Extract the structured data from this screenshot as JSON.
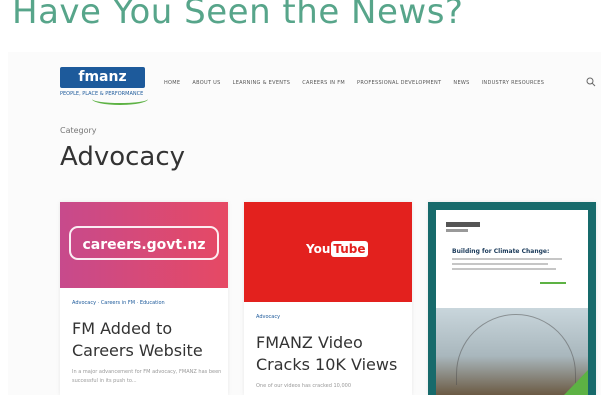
{
  "headline": "Have You Seen the News?",
  "site": {
    "logo_text": "fmanz",
    "logo_tagline": "PEOPLE, PLACE & PERFORMANCE",
    "nav": [
      "HOME",
      "ABOUT US",
      "LEARNING & EVENTS",
      "CAREERS IN FM",
      "PROFESSIONAL DEVELOPMENT",
      "NEWS",
      "INDUSTRY RESOURCES"
    ],
    "search_icon": "search-icon"
  },
  "page": {
    "category_label": "Category",
    "title": "Advocacy"
  },
  "cards": [
    {
      "image_text": "careers.govt.nz",
      "tags": "Advocacy · Careers in FM · Education",
      "title": "FM Added to Careers Website",
      "excerpt": "In a major advancement for FM advocacy, FMANZ has been successful in its push to..."
    },
    {
      "image_text_a": "You",
      "image_text_b": "Tube",
      "tags": "Advocacy",
      "title": "FMANZ Video Cracks 10K Views",
      "excerpt": "One of our videos has cracked 10,000"
    },
    {
      "doc_title": "Building for Climate Change:"
    }
  ],
  "colors": {
    "headline": "#57a58a",
    "brand": "#1d5a9b",
    "accent_green": "#5db244",
    "youtube_red": "#e3211e",
    "teal": "#176a6b"
  }
}
